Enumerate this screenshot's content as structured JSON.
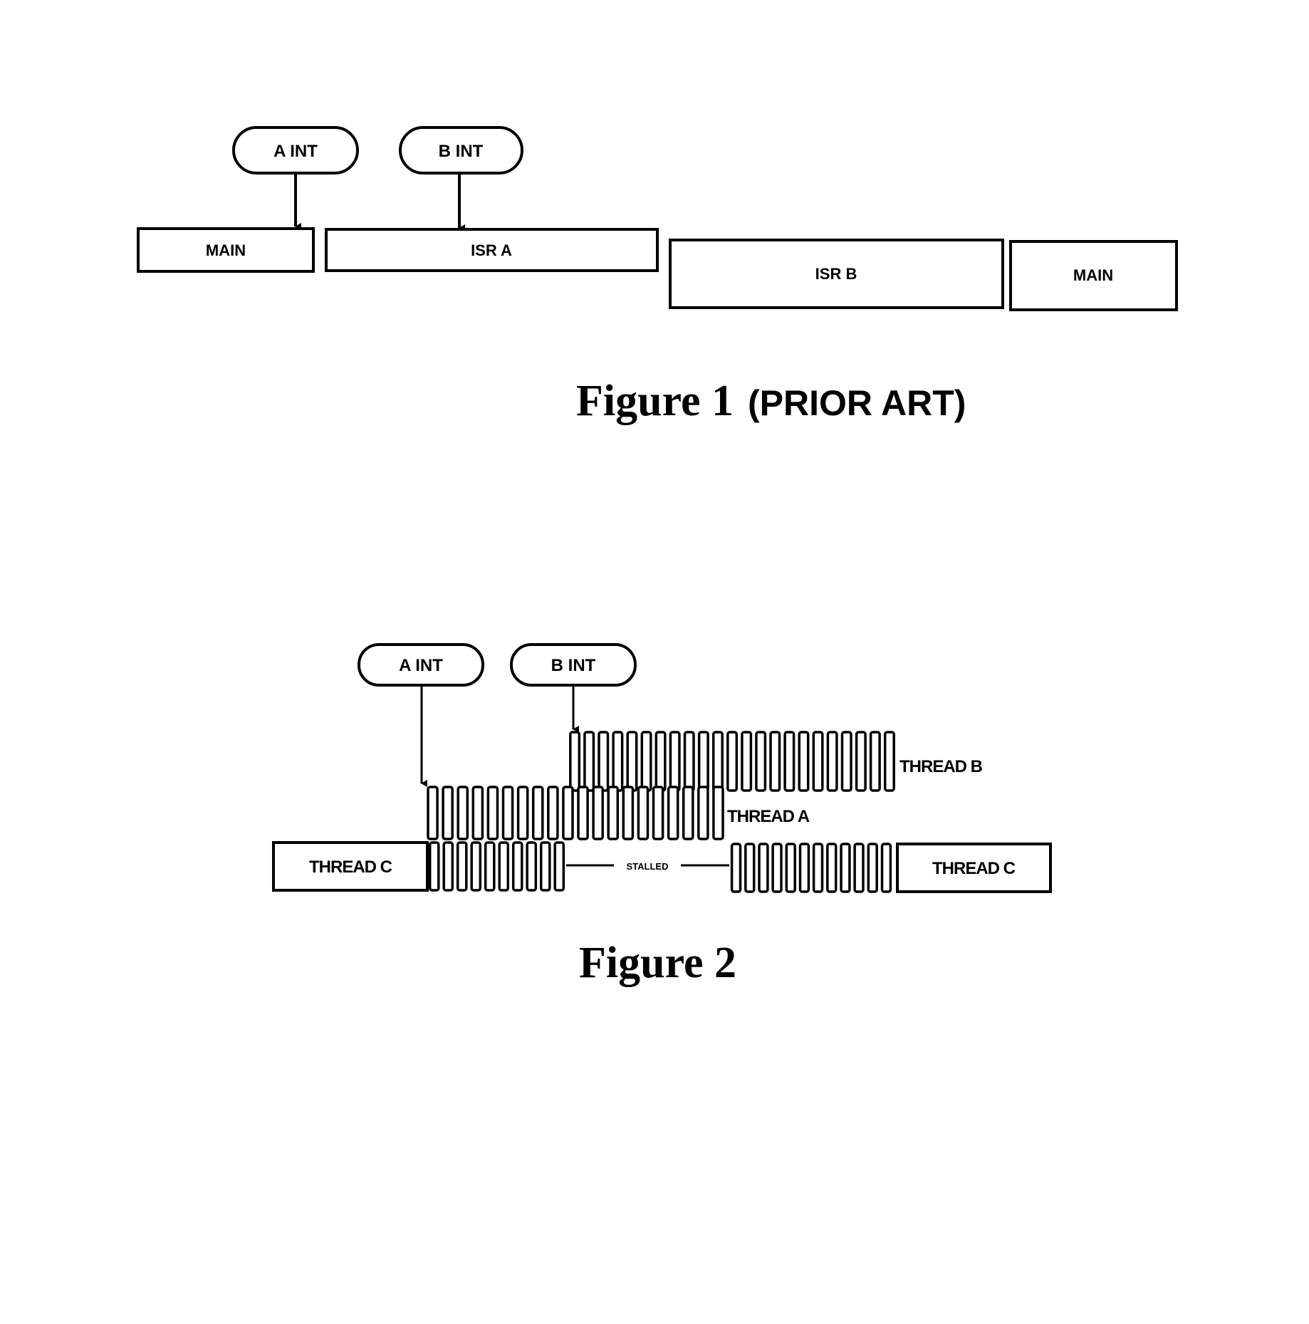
{
  "figure1": {
    "caption_main": "Figure 1",
    "caption_suffix": "(PRIOR ART)",
    "interrupts": [
      {
        "label": "A INT",
        "target": "MAIN"
      },
      {
        "label": "B INT",
        "target": "ISR A"
      }
    ],
    "timeline": [
      {
        "label": "MAIN"
      },
      {
        "label": "ISR A"
      },
      {
        "label": "ISR B"
      },
      {
        "label": "MAIN"
      }
    ]
  },
  "figure2": {
    "caption": "Figure 2",
    "interrupts": [
      {
        "label": "A INT",
        "target": "THREAD A"
      },
      {
        "label": "B INT",
        "target": "THREAD B"
      }
    ],
    "threads": {
      "thread_b": {
        "label": "THREAD B",
        "slices": 23
      },
      "thread_a": {
        "label": "THREAD A",
        "slices": 20
      },
      "thread_c_left": {
        "label": "THREAD C"
      },
      "thread_c_slices_before": 10,
      "stalled_label": "STALLED",
      "thread_c_slices_after": 12,
      "thread_c_right": {
        "label": "THREAD C"
      }
    }
  }
}
